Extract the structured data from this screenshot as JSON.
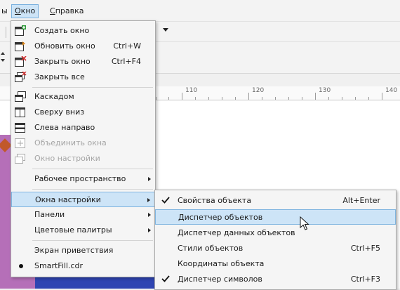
{
  "menubar": {
    "partial_left": "ы",
    "okno": "Окно",
    "okno_underline": "О",
    "okno_rest": "кно",
    "spravka_underline": "С",
    "spravka_rest": "правка"
  },
  "ruler": {
    "labels": [
      "110",
      "120",
      "130",
      "140"
    ]
  },
  "menu": {
    "items": [
      {
        "label": "Создать окно",
        "shortcut": ""
      },
      {
        "label": "Обновить окно",
        "shortcut": "Ctrl+W"
      },
      {
        "label": "Закрыть окно",
        "shortcut": "Ctrl+F4"
      },
      {
        "label": "Закрыть все",
        "shortcut": ""
      },
      {
        "label": "Каскадом",
        "shortcut": ""
      },
      {
        "label": "Сверху вниз",
        "shortcut": ""
      },
      {
        "label": "Слева направо",
        "shortcut": ""
      },
      {
        "label": "Объединить окна",
        "shortcut": ""
      },
      {
        "label": "Окно настройки",
        "shortcut": ""
      },
      {
        "label": "Рабочее пространство",
        "shortcut": ""
      },
      {
        "label": "Окна настройки",
        "shortcut": ""
      },
      {
        "label": "Панели",
        "shortcut": ""
      },
      {
        "label": "Цветовые палитры",
        "shortcut": ""
      },
      {
        "label": "Экран приветствия",
        "shortcut": ""
      },
      {
        "label": "SmartFill.cdr",
        "shortcut": ""
      }
    ]
  },
  "submenu": {
    "items": [
      {
        "label": "Свойства объекта",
        "shortcut": "Alt+Enter",
        "checked": true
      },
      {
        "label": "Диспетчер объектов",
        "shortcut": "",
        "checked": false
      },
      {
        "label": "Диспетчер данных объектов",
        "shortcut": "",
        "checked": false
      },
      {
        "label": "Стили объектов",
        "shortcut": "Ctrl+F5",
        "checked": false
      },
      {
        "label": "Координаты объекта",
        "shortcut": "",
        "checked": false
      },
      {
        "label": "Диспетчер символов",
        "shortcut": "Ctrl+F3",
        "checked": true
      }
    ]
  },
  "colors": {
    "highlight": "#cde4f7",
    "highlight_border": "#80b5e0",
    "disabled_text": "#a5a5a5",
    "canvas_purple": "#b56fb8",
    "canvas_blue": "#2f45b2"
  }
}
